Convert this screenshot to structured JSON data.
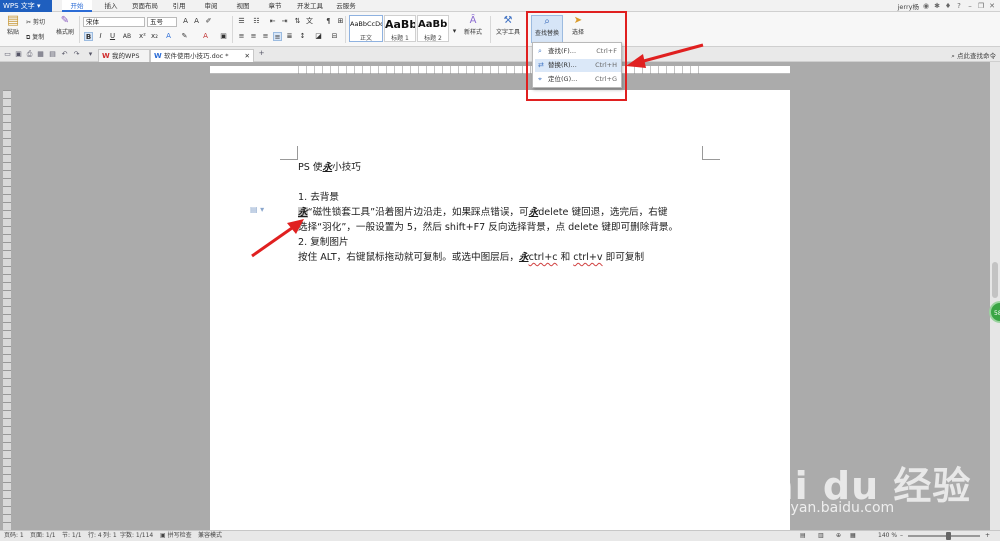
{
  "app": {
    "name": "WPS 文字"
  },
  "menu_tabs": [
    "开始",
    "插入",
    "页面布局",
    "引用",
    "审阅",
    "视图",
    "章节",
    "开发工具",
    "云服务"
  ],
  "user": {
    "name": "jerry杨"
  },
  "ribbon": {
    "clipboard": {
      "paste": "粘贴",
      "cut": "剪切",
      "copy": "复制",
      "format_painter": "格式刷"
    },
    "font": {
      "name": "宋体",
      "size": "五号"
    },
    "styles": [
      {
        "sample": "AaBbCcDd",
        "name": "正文"
      },
      {
        "sample": "AaBb",
        "name": "标题 1"
      },
      {
        "sample": "AaBb(",
        "name": "标题 2"
      }
    ],
    "new_style": "新样式",
    "text_tools": "文字工具",
    "find_replace": "查找替换",
    "select": "选择"
  },
  "dropdown": {
    "items": [
      {
        "label": "查找(F)...",
        "shortcut": "Ctrl+F"
      },
      {
        "label": "替换(R)...",
        "shortcut": "Ctrl+H"
      },
      {
        "label": "定位(G)...",
        "shortcut": "Ctrl+G"
      }
    ]
  },
  "tabs": [
    {
      "label": "我的WPS"
    },
    {
      "label": "软件使用小技巧.doc *"
    }
  ],
  "right_tool": "点此查找命令",
  "document": {
    "title_pre": "PS 使",
    "title_post": "小技巧",
    "glyph": "永",
    "section1": "1. 去背景",
    "line1_post": "“磁性锁套工具”沿着图片边沿走，如果踩点错误，可",
    "line1_tail": "delete 键回退，选完后，右键",
    "line2": "选择“羽化”，一般设置为 5，然后 shift+F7 反向选择背景，点 delete 键即可删除背景。",
    "section2": "2. 复制图片",
    "line3_pre": "按住 ALT，右键鼠标拖动就可复制。或选中图层后，",
    "line3_c": "ctrl+c",
    "line3_mid": " 和 ",
    "line3_v": "ctrl+v",
    "line3_post": " 即可复制"
  },
  "status": {
    "page_no": "页码: 1",
    "pages": "页面: 1/1",
    "section": "节: 1/1",
    "row": "行: 4",
    "col": "列: 1",
    "words": "字数: 1/114",
    "spell": "拼写检查",
    "compat": "兼容模式",
    "zoom": "140 %"
  },
  "watermark": {
    "logo": "Bai  du 经验",
    "url": "jingyan.baidu.com"
  },
  "float_button": "58",
  "colors": {
    "accent": "#2b6cd6",
    "annotation": "#e02020"
  }
}
